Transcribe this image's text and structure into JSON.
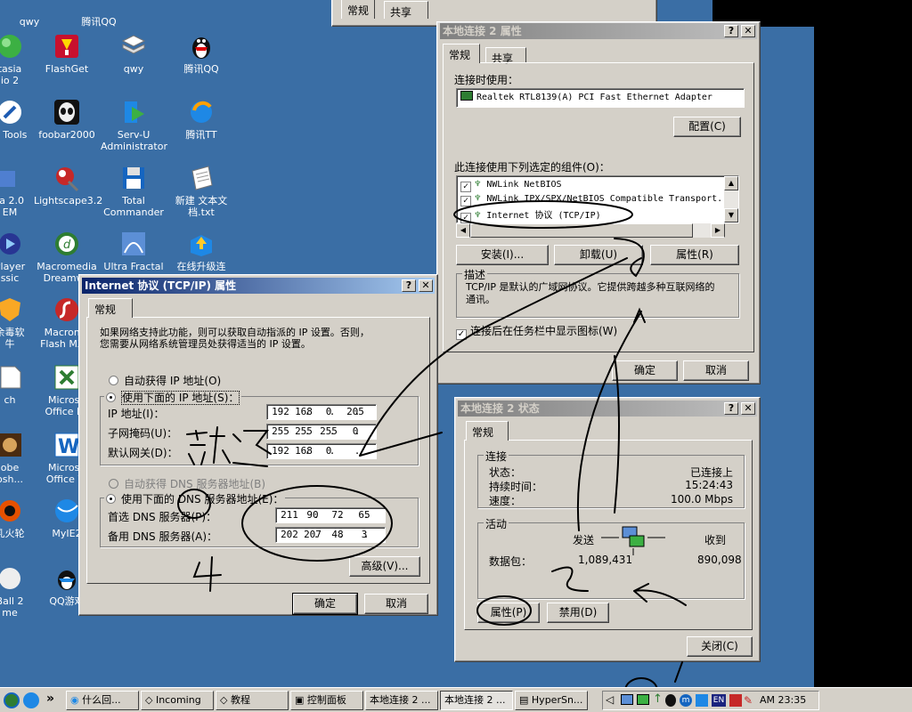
{
  "desktop": {
    "icons": [
      {
        "label": "qwy"
      },
      {
        "label": "腾讯QQ"
      },
      {
        "label": "tasia\nio 2"
      },
      {
        "label": "FlashGet"
      },
      {
        "label": "qwy"
      },
      {
        "label": "腾讯QQ"
      },
      {
        "label": "N Tools"
      },
      {
        "label": "foobar2000"
      },
      {
        "label": "Serv-U\nAdministrator"
      },
      {
        "label": "腾讯TT"
      },
      {
        "label": "ta 2.0\nEM"
      },
      {
        "label": "Lightscape3.2"
      },
      {
        "label": "Total\nCommander"
      },
      {
        "label": "新建 文本文\n档.txt"
      },
      {
        "label": "Player\nssic"
      },
      {
        "label": "Macromedia\nDreamwe"
      },
      {
        "label": "Ultra Fractal"
      },
      {
        "label": "在线升级连"
      },
      {
        "label": "余毒软\n牛"
      },
      {
        "label": "Macrome\nFlash MX 2"
      },
      {
        "label": "ch"
      },
      {
        "label": "Microso\nOffice Ex"
      },
      {
        "label": "obe\nosh..."
      },
      {
        "label": "Microso\nOffice W"
      },
      {
        "label": "乳火轮"
      },
      {
        "label": "MyIE2"
      },
      {
        "label": "Ball 2\nme"
      },
      {
        "label": "QQ游戏"
      }
    ]
  },
  "bg_dialog": {
    "tabs": [
      "常规",
      "共享"
    ]
  },
  "props_dialog": {
    "title": "本地连接 2 属性",
    "tabs": [
      "常规",
      "共享"
    ],
    "connect_using_label": "连接时使用：",
    "adapter": "Realtek RTL8139(A) PCI Fast Ethernet Adapter",
    "configure_btn": "配置(C)",
    "components_label": "此连接使用下列选定的组件(O)：",
    "components": [
      {
        "name": "NWLink NetBIOS",
        "checked": true
      },
      {
        "name": "NWLink IPX/SPX/NetBIOS Compatible Transport...",
        "checked": true
      },
      {
        "name": "Internet 协议 (TCP/IP)",
        "checked": true
      }
    ],
    "install_btn": "安装(I)...",
    "uninstall_btn": "卸载(U)",
    "properties_btn": "属性(R)",
    "desc_label": "描述",
    "desc_text": "TCP/IP 是默认的广域网协议。它提供跨越多种互联网络的通讯。",
    "show_icon_label": "连接后在任务栏中显示图标(W)",
    "ok_btn": "确定",
    "cancel_btn": "取消"
  },
  "tcpip_dialog": {
    "title": "Internet 协议 (TCP/IP) 属性",
    "tab": "常规",
    "intro": "如果网络支持此功能，则可以获取自动指派的 IP 设置。否则，\n您需要从网络系统管理员处获得适当的 IP 设置。",
    "auto_ip": "自动获得 IP 地址(O)",
    "manual_ip": "使用下面的 IP 地址(S)：",
    "ip_label": "IP 地址(I)：",
    "ip": [
      "192",
      "168",
      "0",
      "205"
    ],
    "mask_label": "子网掩码(U)：",
    "mask": [
      "255",
      "255",
      "255",
      "0"
    ],
    "gw_label": "默认网关(D)：",
    "gw": [
      "192",
      "168",
      "0",
      ""
    ],
    "auto_dns": "自动获得 DNS 服务器地址(B)",
    "manual_dns": "使用下面的 DNS 服务器地址(E)：",
    "dns1_label": "首选 DNS 服务器(P)：",
    "dns1": [
      "211",
      "90",
      "72",
      "65"
    ],
    "dns2_label": "备用 DNS 服务器(A)：",
    "dns2": [
      "202",
      "207",
      "48",
      "3"
    ],
    "advanced_btn": "高级(V)...",
    "ok_btn": "确定",
    "cancel_btn": "取消"
  },
  "status_dialog": {
    "title": "本地连接 2 状态",
    "tab": "常规",
    "conn_group": "连接",
    "status_label": "状态：",
    "status_value": "已连接上",
    "duration_label": "持续时间：",
    "duration_value": "15:24:43",
    "speed_label": "速度：",
    "speed_value": "100.0 Mbps",
    "activity_group": "活动",
    "sent_label": "发送",
    "recv_label": "收到",
    "packets_label": "数据包：",
    "sent_value": "1,089,431",
    "recv_value": "890,098",
    "properties_btn": "属性(P)",
    "disable_btn": "禁用(D)",
    "close_btn": "关闭(C)"
  },
  "annotations": {
    "note1": "就这",
    "n2": "2",
    "n3": "3",
    "n4": "4",
    "n1": "1"
  },
  "taskbar": {
    "quick_launch_more": "»",
    "buttons": [
      {
        "label": "什么回..."
      },
      {
        "label": "Incoming"
      },
      {
        "label": "教程"
      },
      {
        "label": "控制面板"
      },
      {
        "label": "本地连接 2 ..."
      },
      {
        "label": "本地连接 2 ..."
      },
      {
        "label": "HyperSn..."
      }
    ],
    "tray_en": "EN",
    "clock": "AM 23:35"
  },
  "colors": {
    "desktop": "#3a6ea5",
    "title_active": "#0a246a",
    "face": "#d4d0c8"
  }
}
